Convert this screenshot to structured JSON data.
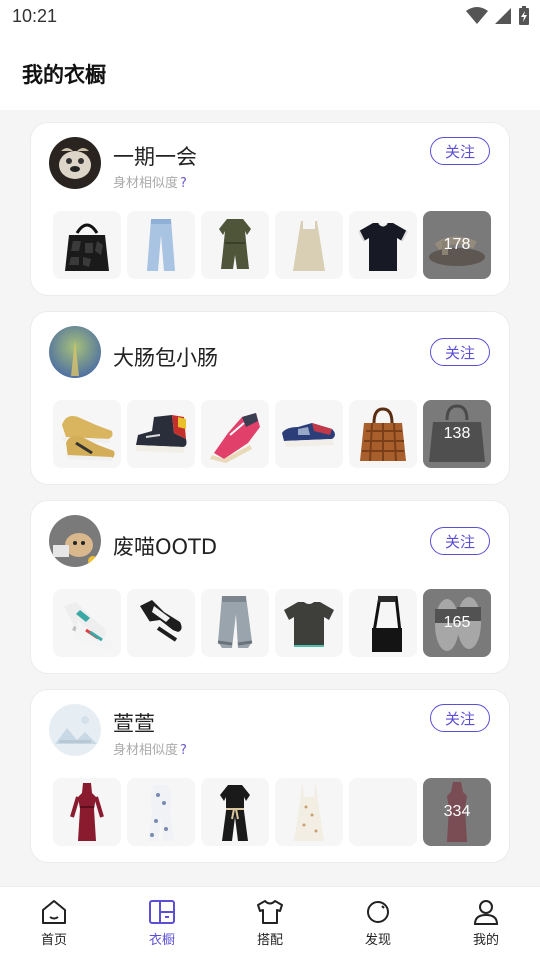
{
  "status_bar": {
    "time": "10:21"
  },
  "header": {
    "title": "我的衣橱"
  },
  "users": [
    {
      "name": "一期一会",
      "similarity_label": "身材相似度",
      "similarity_q": "?",
      "follow_label": "关注",
      "more_count": "178",
      "items": [
        "black-tote-bag",
        "light-blue-jeans",
        "olive-romper",
        "beige-slip-dress",
        "black-t-shirt"
      ],
      "more_item": "brown-sandal"
    },
    {
      "name": "大肠包小肠",
      "follow_label": "关注",
      "more_count": "138",
      "items": [
        "yellow-sneakers",
        "hightop-sneaker",
        "pink-sneaker",
        "blue-sneaker",
        "brown-handbag"
      ],
      "more_item": "black-handbag"
    },
    {
      "name": "废喵OOTD",
      "follow_label": "关注",
      "more_count": "165",
      "items": [
        "teal-sneakers",
        "black-white-sneakers",
        "gray-jogger-pants",
        "black-t-shirt",
        "black-crossbody-bag"
      ],
      "more_item": "slide-sandals"
    },
    {
      "name": "萱萱",
      "similarity_label": "身材相似度",
      "similarity_q": "?",
      "follow_label": "关注",
      "more_count": "334",
      "items": [
        "red-dress",
        "white-floral-jumpsuit",
        "black-jumpsuit",
        "floral-slip-dress",
        "empty"
      ],
      "more_item": "red-dress"
    }
  ],
  "bottom_nav": [
    {
      "label": "首页",
      "icon": "home-icon"
    },
    {
      "label": "衣橱",
      "icon": "wardrobe-icon",
      "active": true
    },
    {
      "label": "搭配",
      "icon": "tshirt-icon"
    },
    {
      "label": "发现",
      "icon": "discover-icon"
    },
    {
      "label": "我的",
      "icon": "profile-icon"
    }
  ],
  "colors": {
    "accent": "#5b4fd6",
    "page_bg": "#f5f5f5",
    "card_bg": "#ffffff"
  }
}
